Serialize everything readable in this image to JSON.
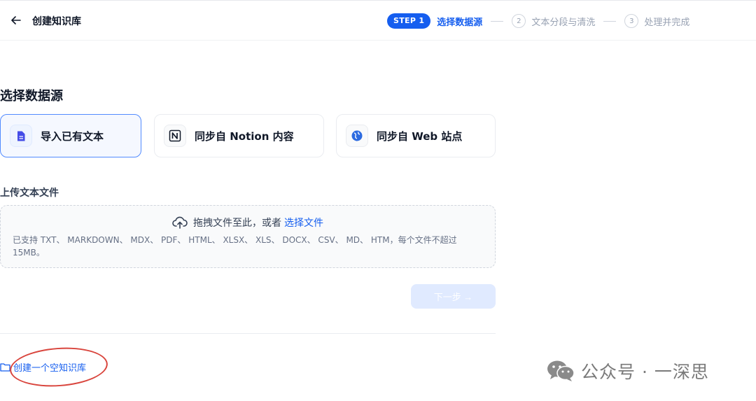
{
  "header": {
    "title": "创建知识库",
    "steps": [
      {
        "badge": "STEP 1",
        "label": "选择数据源"
      },
      {
        "num": "2",
        "label": "文本分段与清洗"
      },
      {
        "num": "3",
        "label": "处理并完成"
      }
    ]
  },
  "main": {
    "section_title": "选择数据源",
    "sources": [
      {
        "label": "导入已有文本",
        "icon": "document-icon"
      },
      {
        "label": "同步自 Notion 内容",
        "icon": "notion-icon"
      },
      {
        "label": "同步自 Web 站点",
        "icon": "globe-icon"
      }
    ],
    "upload": {
      "title": "上传文本文件",
      "prompt": "拖拽文件至此，或者",
      "link": "选择文件",
      "hint": "已支持 TXT、 MARKDOWN、 MDX、 PDF、 HTML、 XLSX、 XLS、 DOCX、 CSV、 MD、 HTM，每个文件不超过 15MB。"
    },
    "next_label": "下一步 →",
    "create_empty": "创建一个空知识库"
  },
  "watermark": "公众号 · 一深思",
  "colors": {
    "accent": "#155eef",
    "annotation": "#d9453d"
  }
}
